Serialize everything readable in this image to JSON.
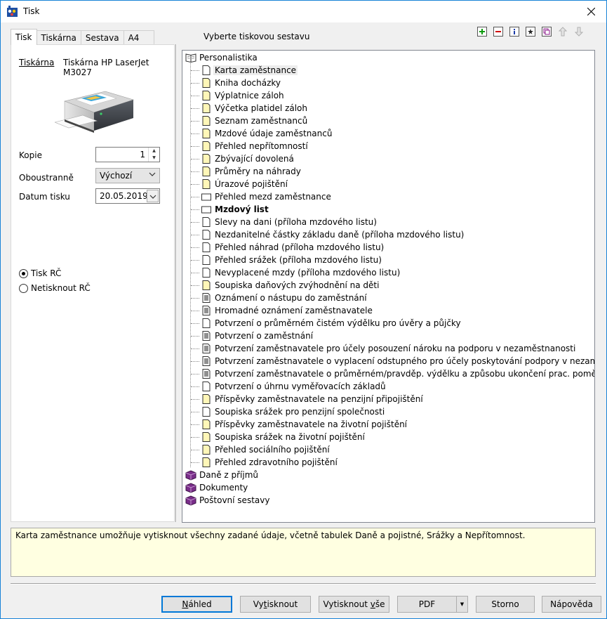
{
  "window": {
    "title": "Tisk"
  },
  "tabs": [
    {
      "label": "Tisk",
      "active": true
    },
    {
      "label": "Tiskárna",
      "active": false
    },
    {
      "label": "Sestava",
      "active": false
    },
    {
      "label": "A4",
      "active": false
    }
  ],
  "left": {
    "printer_label": "Tiskárna",
    "printer_name": "Tiskárna HP LaserJet M3027",
    "copies_label": "Kopie",
    "copies_value": "1",
    "duplex_label": "Oboustranně",
    "duplex_value": "Výchozí",
    "date_label": "Datum tisku",
    "date_value": "20.05.2019",
    "radio_print_rc": "Tisk RČ",
    "radio_no_rc": "Netisknout RČ"
  },
  "select_label": "Vyberte tiskovou sestavu",
  "toolbar": [
    "add-icon",
    "remove-icon",
    "info-icon",
    "star-icon",
    "copy-icon",
    "move-up-icon",
    "move-down-icon"
  ],
  "tree": {
    "root": "Personalistika",
    "items": [
      {
        "label": "Karta zaměstnance",
        "icon": "doc-white",
        "selected": true
      },
      {
        "label": "Kniha docházky",
        "icon": "doc-yellow"
      },
      {
        "label": "Výplatnice záloh",
        "icon": "doc-yellow"
      },
      {
        "label": "Výčetka platidel záloh",
        "icon": "doc-yellow"
      },
      {
        "label": "Seznam zaměstnanců",
        "icon": "doc-yellow"
      },
      {
        "label": "Mzdové údaje zaměstnanců",
        "icon": "doc-yellow"
      },
      {
        "label": "Přehled nepřítomností",
        "icon": "doc-yellow"
      },
      {
        "label": "Zbývající dovolená",
        "icon": "doc-yellow"
      },
      {
        "label": "Průměry na náhrady",
        "icon": "doc-yellow"
      },
      {
        "label": "Úrazové pojištění",
        "icon": "doc-yellow"
      },
      {
        "label": "Přehled mezd zaměstnance",
        "icon": "doc-landscape"
      },
      {
        "label": "Mzdový list",
        "icon": "doc-landscape",
        "bold": true
      },
      {
        "label": "Slevy na dani (příloha mzdového listu)",
        "icon": "doc-white"
      },
      {
        "label": "Nezdanitelné částky základu daně (příloha mzdového listu)",
        "icon": "doc-white"
      },
      {
        "label": "Přehled náhrad (příloha mzdového listu)",
        "icon": "doc-white"
      },
      {
        "label": "Přehled srážek (příloha mzdového listu)",
        "icon": "doc-white"
      },
      {
        "label": "Nevyplacené mzdy (příloha mzdového listu)",
        "icon": "doc-white"
      },
      {
        "label": "Soupiska daňových zvýhodnění na děti",
        "icon": "doc-yellow"
      },
      {
        "label": "Oznámení o nástupu do zaměstnání",
        "icon": "doc-form"
      },
      {
        "label": "Hromadné oznámení zaměstnavatele",
        "icon": "doc-form"
      },
      {
        "label": "Potvrzení o průměrném čistém výdělku pro úvěry a půjčky",
        "icon": "doc-white"
      },
      {
        "label": "Potvrzení o zaměstnání",
        "icon": "doc-form"
      },
      {
        "label": "Potvrzení zaměstnavatele pro účely posouzení nároku na podporu v nezaměstnanosti",
        "icon": "doc-form"
      },
      {
        "label": "Potvrzení zaměstnavatele o vyplacení odstupného pro účely poskytování podpory v nezaměstnanosti",
        "icon": "doc-form"
      },
      {
        "label": "Potvrzení zaměstnavatele o průměrném/pravděp. výdělku a způsobu ukončení prac. poměru",
        "icon": "doc-form"
      },
      {
        "label": "Potvrzení o úhrnu vyměřovacích základů",
        "icon": "doc-white"
      },
      {
        "label": "Příspěvky zaměstnavatele na penzijní připojištění",
        "icon": "doc-yellow"
      },
      {
        "label": "Soupiska srážek pro penzijní společnosti",
        "icon": "doc-white"
      },
      {
        "label": "Příspěvky zaměstnavatele na životní pojištění",
        "icon": "doc-yellow"
      },
      {
        "label": "Soupiska srážek na životní pojištění",
        "icon": "doc-yellow"
      },
      {
        "label": "Přehled sociálního pojištění",
        "icon": "doc-yellow"
      },
      {
        "label": "Přehled zdravotního pojištění",
        "icon": "doc-yellow"
      }
    ],
    "groups": [
      "Daně z příjmů",
      "Dokumenty",
      "Poštovní sestavy"
    ]
  },
  "description": "Karta zaměstnance umožňuje vytisknout všechny zadané údaje, včetně tabulek Daně a pojistné, Srážky a Nepřítomnost.",
  "buttons": {
    "preview_u": "N",
    "preview_rest": "áhled",
    "print_a": "Vy",
    "print_u": "t",
    "print_b": "isknout",
    "printall_a": "Vytisknout ",
    "printall_u": "v",
    "printall_b": "še",
    "pdf": "PDF",
    "cancel": "Storno",
    "help": "Nápověda"
  }
}
